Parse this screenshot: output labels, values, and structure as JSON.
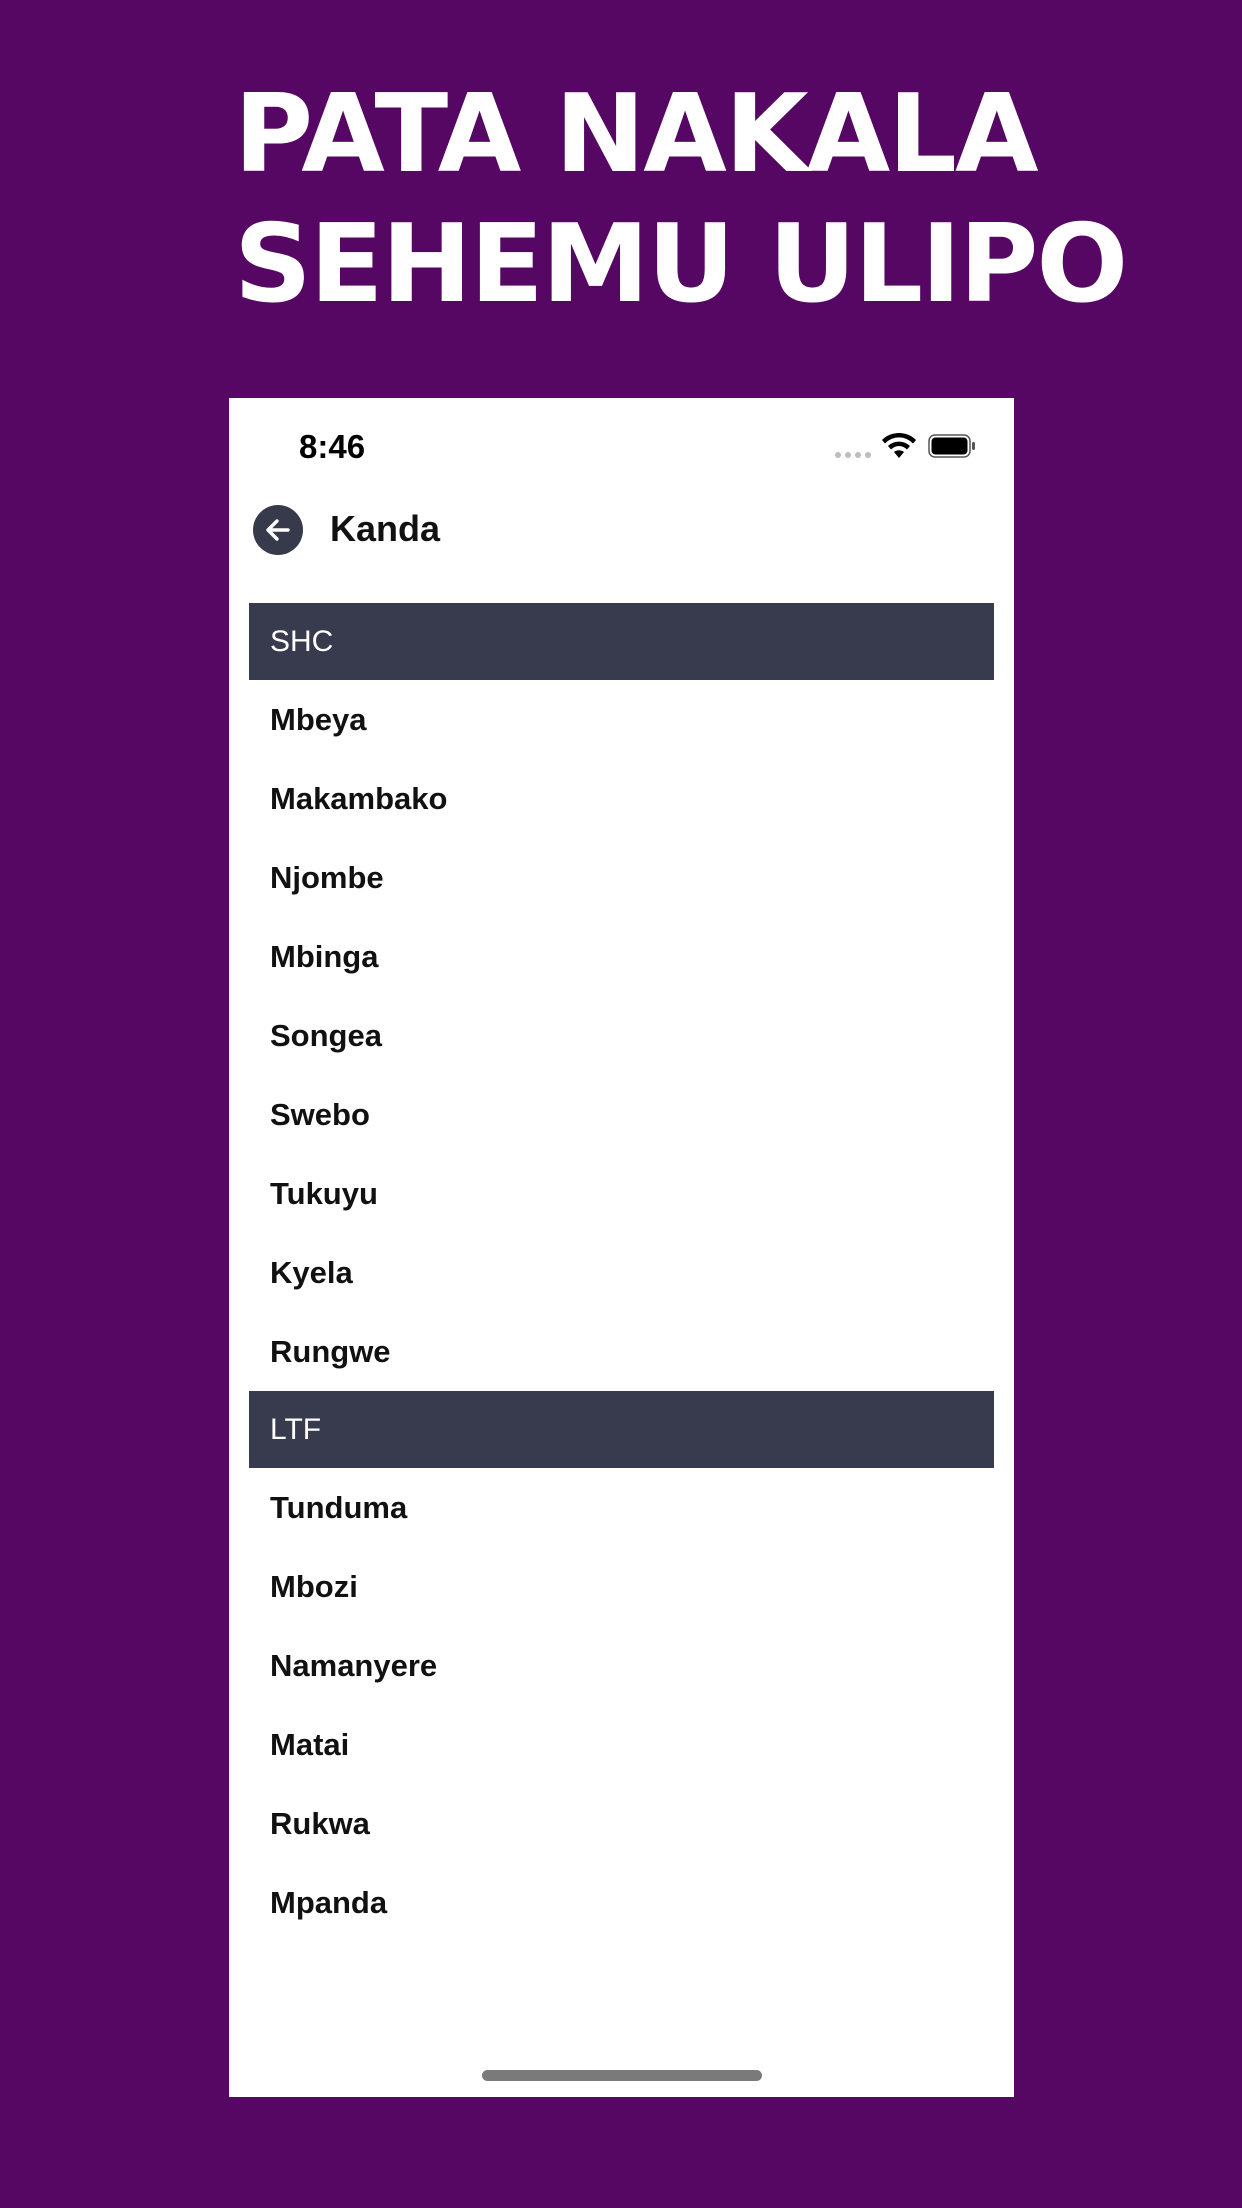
{
  "promo": {
    "headline_line1": "PATA NAKALA",
    "headline_line2": "SEHEMU ULIPO"
  },
  "status_bar": {
    "time": "8:46"
  },
  "nav": {
    "title": "Kanda"
  },
  "sections": [
    {
      "header": "SHC",
      "items": [
        "Mbeya",
        "Makambako",
        "Njombe",
        "Mbinga",
        "Songea",
        "Swebo",
        "Tukuyu",
        "Kyela",
        "Rungwe"
      ]
    },
    {
      "header": "LTF",
      "items": [
        "Tunduma",
        "Mbozi",
        "Namanyere",
        "Matai",
        "Rukwa",
        "Mpanda"
      ]
    }
  ],
  "colors": {
    "background": "#560764",
    "section_header": "#383b4d",
    "back_button": "#363a4b"
  }
}
